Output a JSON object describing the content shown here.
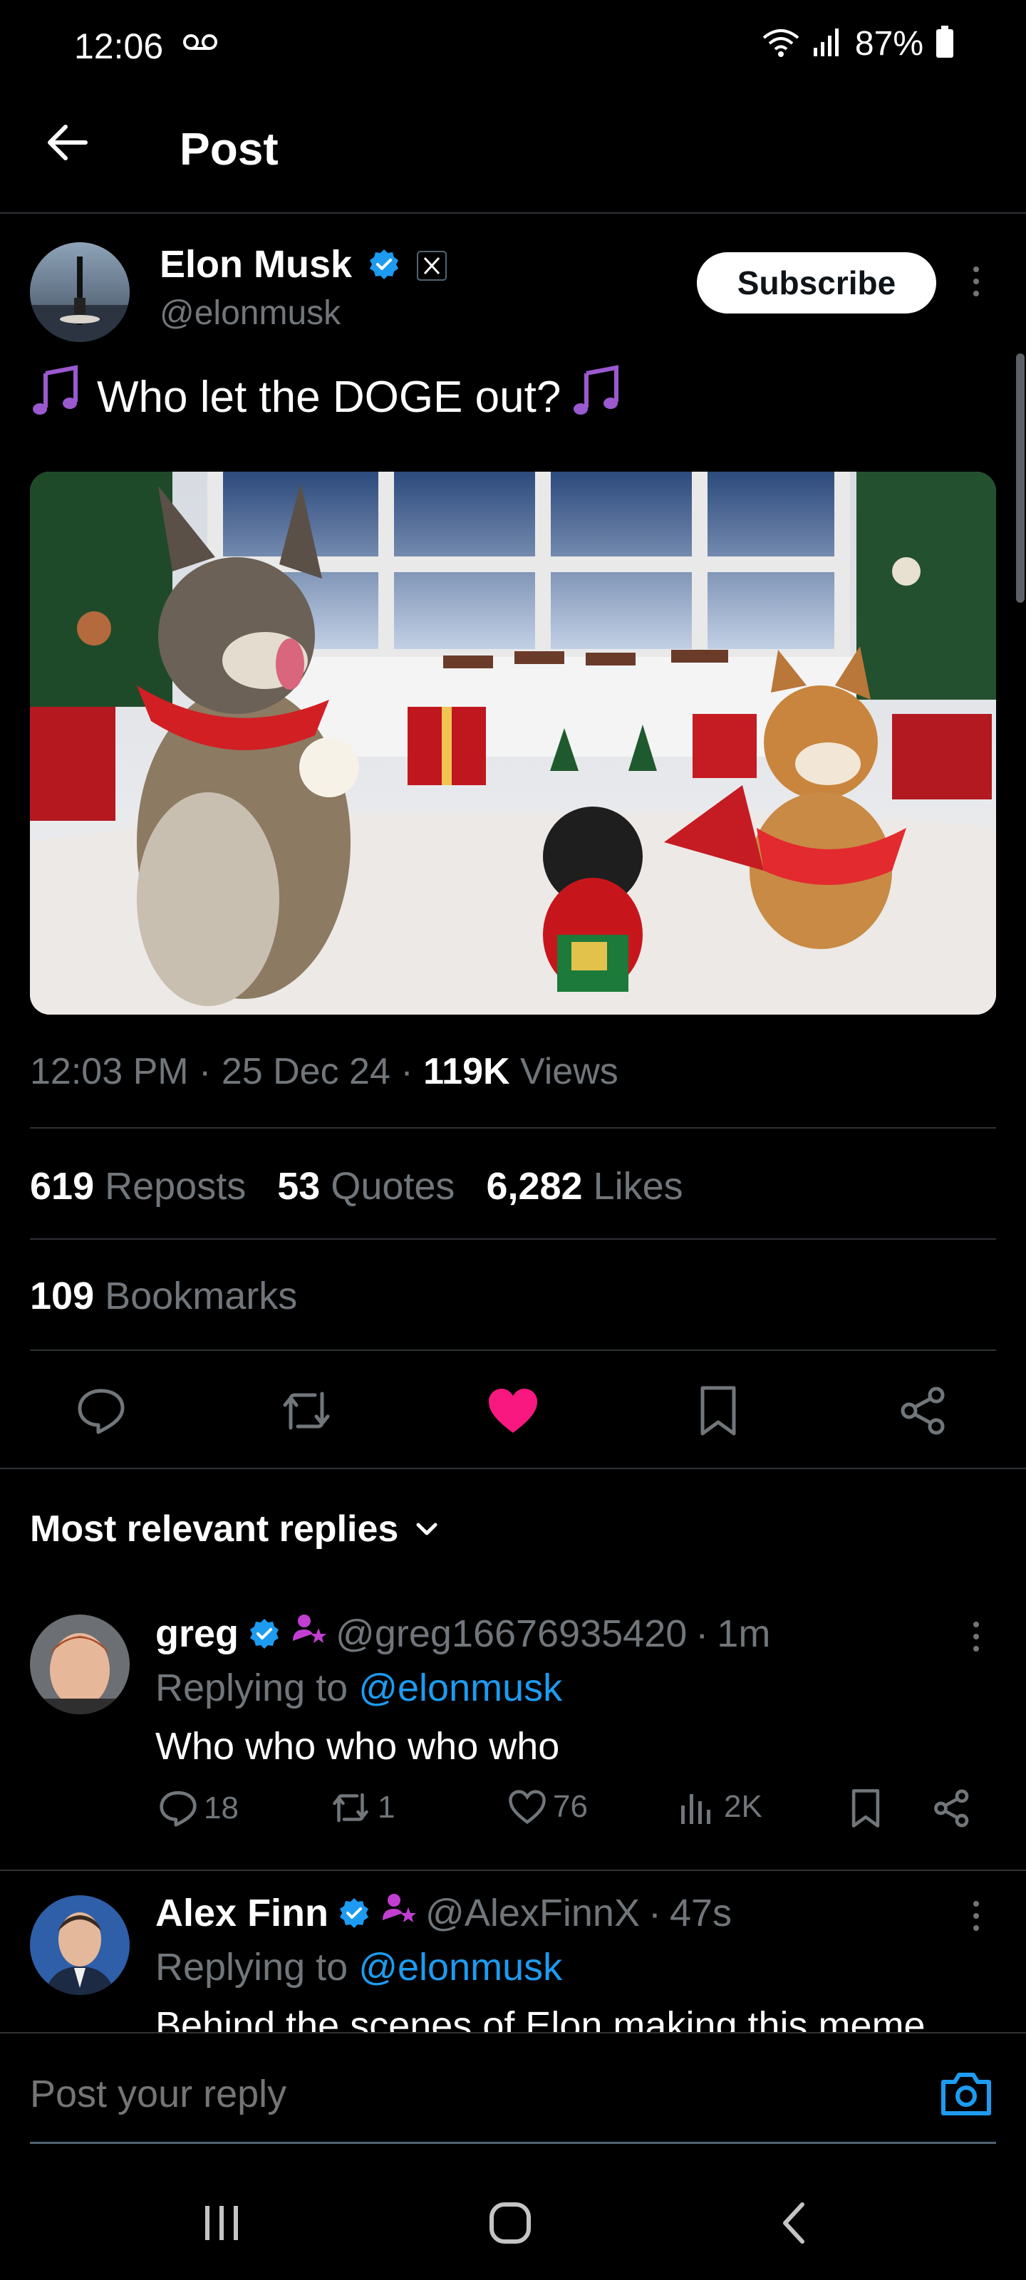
{
  "status_bar": {
    "time": "12:06",
    "battery": "87%",
    "icons": [
      "voicemail-icon",
      "wifi-icon",
      "signal-icon",
      "battery-icon"
    ]
  },
  "header": {
    "title": "Post",
    "back_icon": "arrow-left-icon"
  },
  "post": {
    "author_name": "Elon Musk",
    "author_handle": "@elonmusk",
    "subscribe_label": "Subscribe",
    "text": "Who let the DOGE out?",
    "text_emoji": "music-notes-icon",
    "meta": {
      "time": "12:03 PM",
      "date": "25 Dec 24",
      "views_count": "119K",
      "views_label": "Views",
      "sep": "·"
    },
    "stats": {
      "reposts_count": "619",
      "reposts_label": "Reposts",
      "quotes_count": "53",
      "quotes_label": "Quotes",
      "likes_count": "6,282",
      "likes_label": "Likes",
      "bookmarks_count": "109",
      "bookmarks_label": "Bookmarks"
    },
    "actions": [
      "reply-icon",
      "repost-icon",
      "like-icon",
      "bookmark-icon",
      "share-icon"
    ]
  },
  "replies_header": {
    "label": "Most relevant replies"
  },
  "replies": [
    {
      "name": "greg",
      "handle": "@greg16676935420",
      "time": "1m",
      "replying_prefix": "Replying to",
      "replying_to": "@elonmusk",
      "text": "Who who who who who",
      "replies": "18",
      "reposts": "1",
      "likes": "76",
      "views": "2K"
    },
    {
      "name": "Alex Finn",
      "handle": "@AlexFinnX",
      "time": "47s",
      "replying_prefix": "Replying to",
      "replying_to": "@elonmusk",
      "text": "Behind the scenes of Elon making this meme"
    }
  ],
  "composer": {
    "placeholder": "Post your reply",
    "camera_icon": "camera-icon"
  },
  "colors": {
    "background": "#000000",
    "accent": "#1d9bf0",
    "like": "#f91880",
    "muted": "#71767b"
  }
}
